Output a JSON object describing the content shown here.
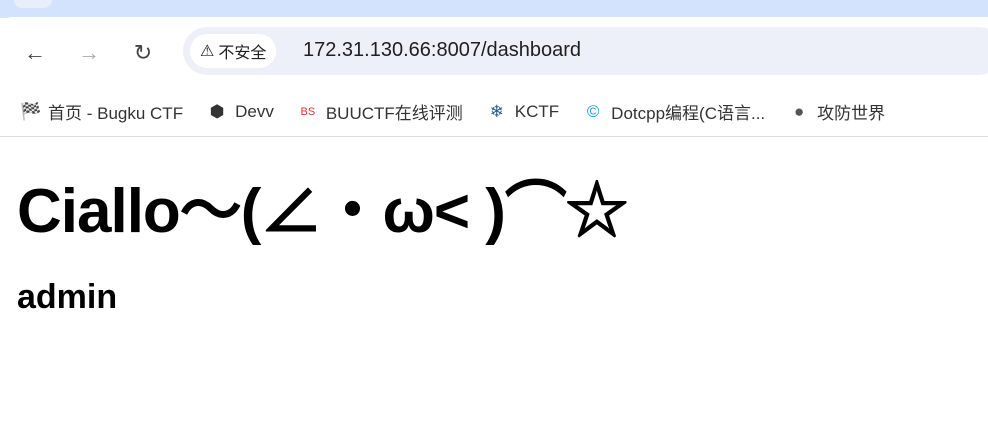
{
  "browser": {
    "security_label": "不安全",
    "url": "172.31.130.66:8007/dashboard",
    "bookmarks": [
      {
        "icon": "checkered-flag-icon",
        "label": "首页 - Bugku CTF"
      },
      {
        "icon": "cube-icon",
        "label": "Devv"
      },
      {
        "icon": "buuctf-logo-icon",
        "label": "BUUCTF在线评测"
      },
      {
        "icon": "snowflake-icon",
        "label": "KCTF"
      },
      {
        "icon": "dotcpp-logo-icon",
        "label": "Dotcpp编程(C语言..."
      },
      {
        "icon": "globe-icon",
        "label": "攻防世界"
      }
    ]
  },
  "page": {
    "title": "Ciallo～(∠・ω< )⌒☆",
    "username": "admin"
  }
}
